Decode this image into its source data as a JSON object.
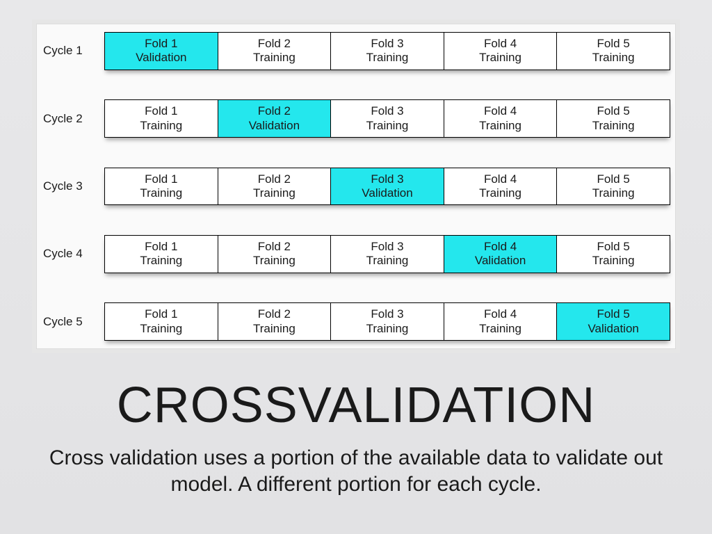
{
  "title": "CROSSVALIDATION",
  "description": "Cross validation uses a portion of the available data to validate out model.  A different portion for each cycle.",
  "cycles": [
    {
      "label": "Cycle 1",
      "folds": [
        {
          "line1": "Fold 1",
          "line2": "Validation",
          "validation": true
        },
        {
          "line1": "Fold 2",
          "line2": "Training",
          "validation": false
        },
        {
          "line1": "Fold 3",
          "line2": "Training",
          "validation": false
        },
        {
          "line1": "Fold 4",
          "line2": "Training",
          "validation": false
        },
        {
          "line1": "Fold 5",
          "line2": "Training",
          "validation": false
        }
      ]
    },
    {
      "label": "Cycle 2",
      "folds": [
        {
          "line1": "Fold 1",
          "line2": "Training",
          "validation": false
        },
        {
          "line1": "Fold 2",
          "line2": "Validation",
          "validation": true
        },
        {
          "line1": "Fold 3",
          "line2": "Training",
          "validation": false
        },
        {
          "line1": "Fold 4",
          "line2": "Training",
          "validation": false
        },
        {
          "line1": "Fold 5",
          "line2": "Training",
          "validation": false
        }
      ]
    },
    {
      "label": "Cycle 3",
      "folds": [
        {
          "line1": "Fold 1",
          "line2": "Training",
          "validation": false
        },
        {
          "line1": "Fold 2",
          "line2": "Training",
          "validation": false
        },
        {
          "line1": "Fold 3",
          "line2": "Validation",
          "validation": true
        },
        {
          "line1": "Fold 4",
          "line2": "Training",
          "validation": false
        },
        {
          "line1": "Fold 5",
          "line2": "Training",
          "validation": false
        }
      ]
    },
    {
      "label": "Cycle 4",
      "folds": [
        {
          "line1": "Fold 1",
          "line2": "Training",
          "validation": false
        },
        {
          "line1": "Fold 2",
          "line2": "Training",
          "validation": false
        },
        {
          "line1": "Fold 3",
          "line2": "Training",
          "validation": false
        },
        {
          "line1": "Fold 4",
          "line2": "Validation",
          "validation": true
        },
        {
          "line1": "Fold 5",
          "line2": "Training",
          "validation": false
        }
      ]
    },
    {
      "label": "Cycle 5",
      "folds": [
        {
          "line1": "Fold 1",
          "line2": "Training",
          "validation": false
        },
        {
          "line1": "Fold 2",
          "line2": "Training",
          "validation": false
        },
        {
          "line1": "Fold 3",
          "line2": "Training",
          "validation": false
        },
        {
          "line1": "Fold 4",
          "line2": "Training",
          "validation": false
        },
        {
          "line1": "Fold 5",
          "line2": "Validation",
          "validation": true
        }
      ]
    }
  ]
}
